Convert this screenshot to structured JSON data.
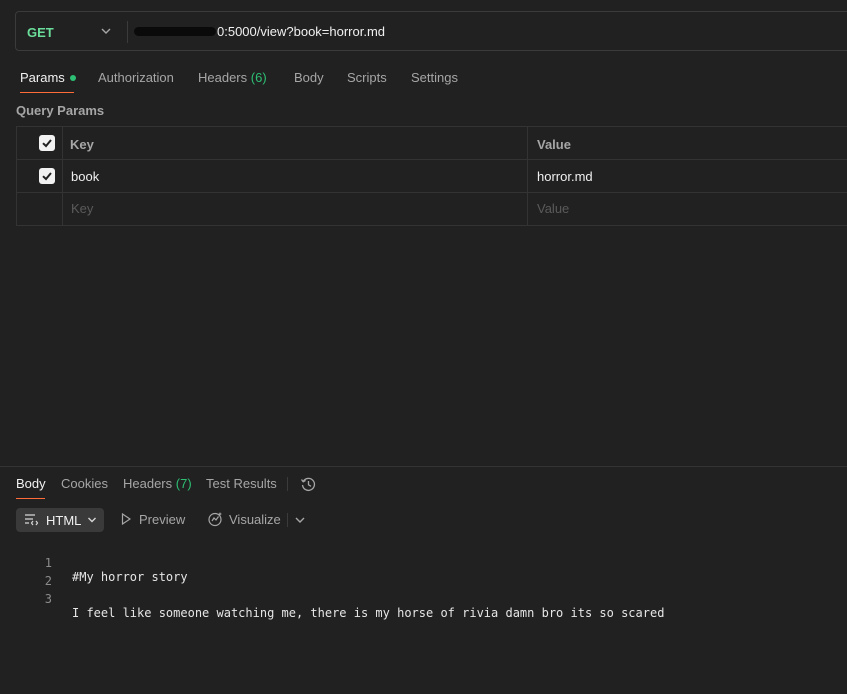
{
  "request": {
    "method": "GET",
    "url_visible": "0:5000/view?book=horror.md"
  },
  "request_tabs": [
    {
      "label": "Params",
      "active": true,
      "dot": true
    },
    {
      "label": "Authorization"
    },
    {
      "label": "Headers",
      "count": "(6)"
    },
    {
      "label": "Body"
    },
    {
      "label": "Scripts"
    },
    {
      "label": "Settings"
    }
  ],
  "query_params": {
    "section_label": "Query Params",
    "columns": [
      "Key",
      "Value"
    ],
    "rows": [
      {
        "checked": true,
        "key": "book",
        "value": "horror.md"
      }
    ],
    "new_row": {
      "key_placeholder": "Key",
      "value_placeholder": "Value"
    }
  },
  "response_tabs": [
    {
      "label": "Body",
      "active": true
    },
    {
      "label": "Cookies"
    },
    {
      "label": "Headers",
      "count": "(7)"
    },
    {
      "label": "Test Results"
    }
  ],
  "response_toolbar": {
    "format": "HTML",
    "preview": "Preview",
    "visualize": "Visualize"
  },
  "response_body": {
    "lines": [
      {
        "n": "1",
        "text": "#My horror story"
      },
      {
        "n": "2",
        "text": ""
      },
      {
        "n": "3",
        "text": "I feel like someone watching me, there is my horse of rivia damn bro its so scared"
      }
    ]
  },
  "colors": {
    "background": "#212121",
    "method_green": "#6bdd9a",
    "accent_orange": "#ff6c37",
    "count_green": "#2dbf73"
  }
}
